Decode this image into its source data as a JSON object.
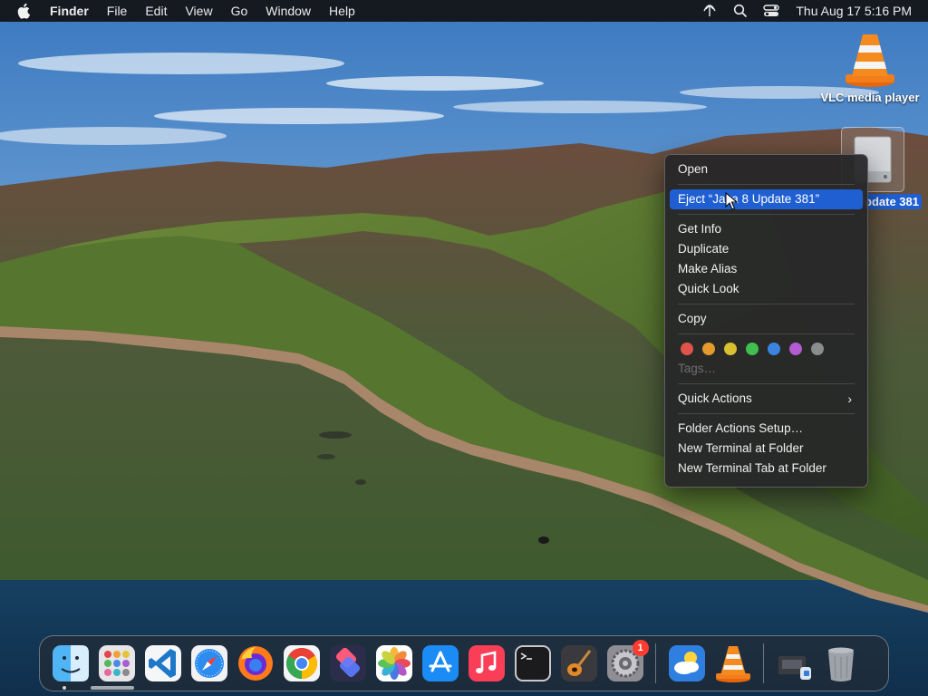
{
  "menubar": {
    "app_name": "Finder",
    "menus": [
      "File",
      "Edit",
      "View",
      "Go",
      "Window",
      "Help"
    ],
    "clock": "Thu Aug 17  5:16 PM",
    "status_icons": [
      "airdrop-icon",
      "search-icon",
      "control-center-icon"
    ]
  },
  "desktop": {
    "icons": [
      {
        "label": "VLC media player",
        "icon": "vlc-cone-icon"
      },
      {
        "label": "Java 8 Update 381",
        "icon": "disk-image-icon",
        "selected": true
      }
    ]
  },
  "context_menu": {
    "items": {
      "open": "Open",
      "eject": "Eject “Java 8 Update 381”",
      "get_info": "Get Info",
      "duplicate": "Duplicate",
      "make_alias": "Make Alias",
      "quick_look": "Quick Look",
      "copy": "Copy",
      "tags": "Tags…",
      "quick_actions": "Quick Actions",
      "folder_actions_setup": "Folder Actions Setup…",
      "new_terminal": "New Terminal at Folder",
      "new_terminal_tab": "New Terminal Tab at Folder"
    },
    "highlighted": "eject",
    "tag_colors": [
      "#e0534c",
      "#e39b2b",
      "#d6c130",
      "#3fbf4f",
      "#3a84e0",
      "#b35bd0",
      "#8c8c8e"
    ],
    "accent": "#1f5fd1"
  },
  "dock": {
    "apps": [
      {
        "name": "Finder",
        "icon": "finder-icon"
      },
      {
        "name": "Launchpad",
        "icon": "launchpad-icon"
      },
      {
        "name": "Visual Studio Code",
        "icon": "vscode-icon"
      },
      {
        "name": "Safari",
        "icon": "safari-icon"
      },
      {
        "name": "Firefox",
        "icon": "firefox-icon"
      },
      {
        "name": "Google Chrome",
        "icon": "chrome-icon"
      },
      {
        "name": "Shortcuts",
        "icon": "shortcuts-icon"
      },
      {
        "name": "Photos",
        "icon": "photos-icon"
      },
      {
        "name": "App Store",
        "icon": "app-store-icon"
      },
      {
        "name": "Music",
        "icon": "music-icon"
      },
      {
        "name": "Terminal",
        "icon": "terminal-icon"
      },
      {
        "name": "GarageBand",
        "icon": "garageband-icon"
      },
      {
        "name": "System Settings",
        "icon": "settings-icon",
        "badge": "1"
      },
      {
        "name": "Weather",
        "icon": "weather-icon"
      },
      {
        "name": "VLC",
        "icon": "vlc-cone-icon"
      },
      {
        "name": "Downloads",
        "icon": "downloads-stack-icon"
      },
      {
        "name": "Trash",
        "icon": "trash-icon"
      }
    ]
  }
}
